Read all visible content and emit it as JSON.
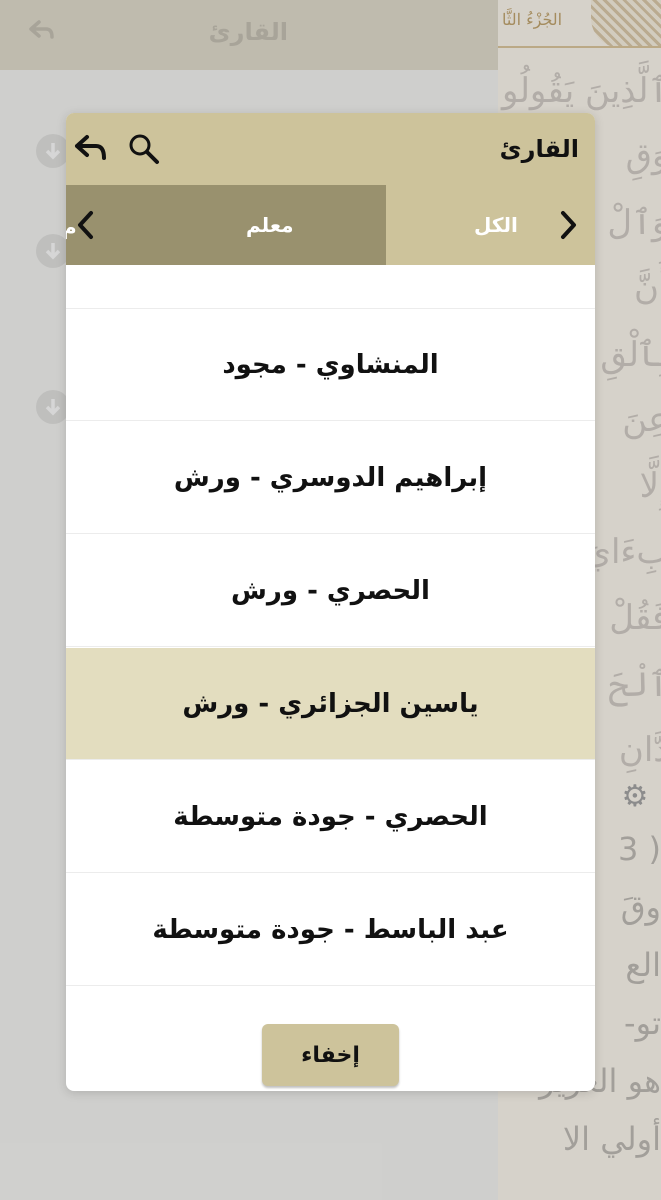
{
  "background": {
    "header_title": "القارئ",
    "juz_label": "الجُزْءُ الثَّا",
    "quran_lines": [
      "ٱلَّذِينَ يَقُولُو",
      "وَقِ",
      "وَٱلْ",
      "أَنَّ",
      "بِٱلْقِ",
      "عِنَ",
      "إِلَّا",
      "بِءَايَ",
      "فَقُلْ",
      "ٱلْحَ",
      "دَّانِ"
    ],
    "translation_lines": [
      "( 3",
      "وقَ",
      "الع",
      "تو-",
      "هو العزيز",
      "أولي الا"
    ]
  },
  "dialog": {
    "title": "القارئ",
    "tabs": [
      {
        "label": "الكل"
      },
      {
        "label": "معلم",
        "active": true
      },
      {
        "label": "م"
      }
    ],
    "reciters": [
      "المنشاوي - مجود",
      "إبراهيم الدوسري - ورش",
      "الحصري - ورش",
      "ياسين الجزائري - ورش",
      "الحصري - جودة متوسطة",
      "عبد الباسط - جودة متوسطة"
    ],
    "selected_index": 3,
    "hide_label": "إخفاء"
  },
  "colors": {
    "header": "#cdc39b",
    "active_tab": "#99916e",
    "selected_row": "#e3ddbf"
  },
  "icons": {
    "back": "back-arrow-icon",
    "search": "search-icon",
    "prev": "chevron-left-icon",
    "next": "chevron-right-icon",
    "settings": "gear-icon",
    "download": "download-icon"
  }
}
